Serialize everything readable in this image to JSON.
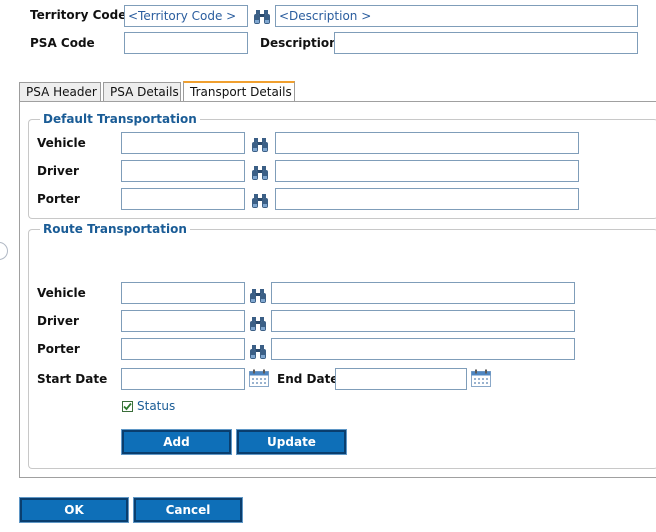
{
  "header": {
    "territory_code_label": "Territory Code",
    "territory_code_placeholder": "<Territory Code >",
    "description_placeholder": "<Description >",
    "psa_code_label": "PSA Code",
    "description_label": "Description"
  },
  "tabs": [
    {
      "label": "PSA Header",
      "active": false
    },
    {
      "label": "PSA Details",
      "active": false
    },
    {
      "label": "Transport Details",
      "active": true
    }
  ],
  "default_transport": {
    "legend": "Default Transportation",
    "vehicle_label": "Vehicle",
    "driver_label": "Driver",
    "porter_label": "Porter"
  },
  "route_transport": {
    "legend": "Route Transportation",
    "vehicle_label": "Vehicle",
    "driver_label": "Driver",
    "porter_label": "Porter",
    "start_date_label": "Start Date",
    "end_date_label": "End Date",
    "status_label": "Status",
    "status_checked": true,
    "add_label": "Add",
    "update_label": "Update"
  },
  "footer": {
    "ok_label": "OK",
    "cancel_label": "Cancel"
  },
  "colors": {
    "accent": "#1a5c96",
    "button_bg": "#0e6fb8",
    "active_tab_border": "#f0a030"
  },
  "icons": {
    "lookup": "binoculars-icon",
    "calendar": "calendar-icon"
  }
}
